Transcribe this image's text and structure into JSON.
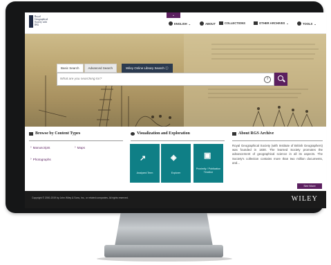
{
  "header": {
    "logo_text": "Royal Geographical Society with IBG",
    "nav": [
      {
        "label": "ENGLISH",
        "icon": "globe-icon"
      },
      {
        "label": "ABOUT",
        "icon": "info-icon"
      },
      {
        "label": "COLLECTIONS",
        "icon": "collections-icon"
      },
      {
        "label": "OTHER ARCHIVES",
        "icon": "archives-icon"
      },
      {
        "label": "TOOLS",
        "icon": "gear-icon"
      }
    ]
  },
  "search": {
    "tabs": [
      "Basic Search",
      "Advanced Search",
      "Wiley Online Library Search"
    ],
    "placeholder": "What are you searching for?"
  },
  "browse": {
    "title": "Browse by Content Types",
    "items": [
      "Manuscripts",
      "Maps",
      "Photographs"
    ]
  },
  "visualization": {
    "title": "Visualization and Exploration",
    "tiles": [
      "Analyzed Term",
      "Explorer",
      "Proximity / Publication Timeline"
    ]
  },
  "about": {
    "title": "About RGS Archive",
    "text": "Royal Geographical Society (with Institute of British Geographers) was founded in 1830. The learned Society promotes the advancement of geographical science in all its aspects. The Society's collection contains more than two million documents, and...",
    "button": "See More"
  },
  "footer": {
    "copyright": "Copyright © 2000-2019 by John Wiley & Sons, Inc., or related companies. All rights reserved.",
    "brand": "WILEY"
  },
  "colors": {
    "accent": "#5b1f5f",
    "teal": "#0f7f86",
    "footer": "#1b1b1b"
  }
}
